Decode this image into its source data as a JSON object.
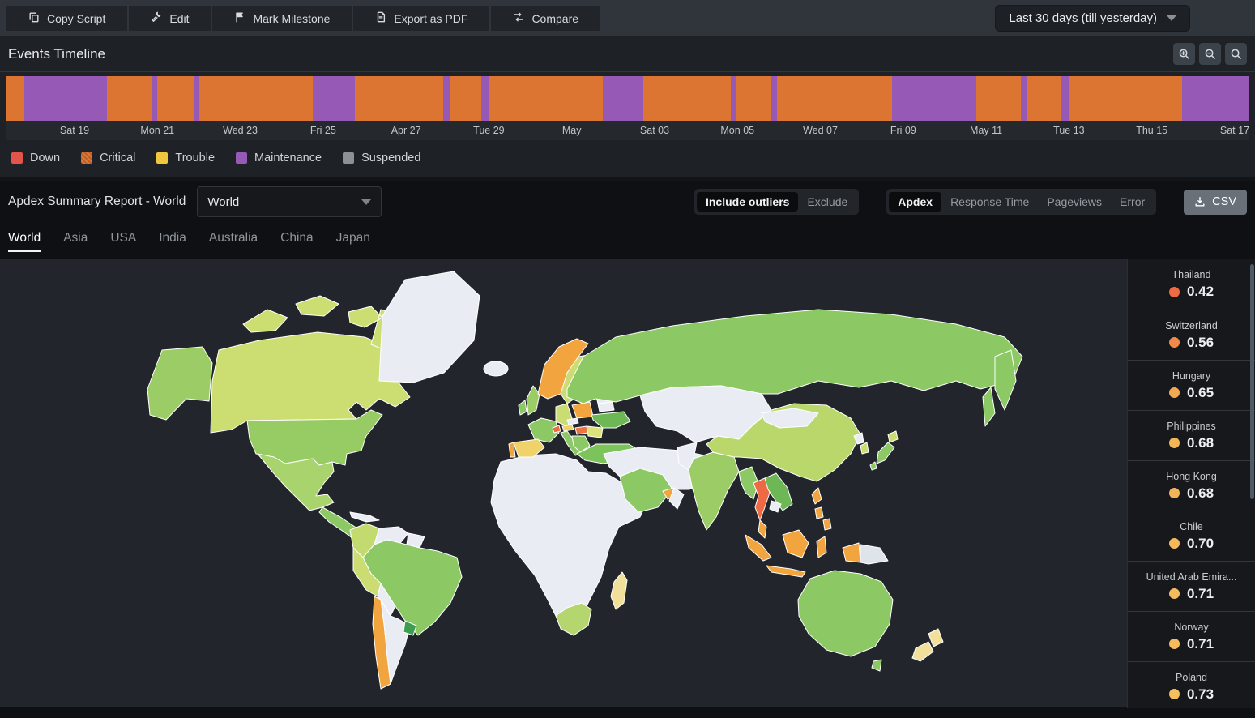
{
  "toolbar": {
    "buttons": [
      {
        "label": "Copy Script",
        "icon": "copy-icon"
      },
      {
        "label": "Edit",
        "icon": "edit-icon"
      },
      {
        "label": "Mark Milestone",
        "icon": "flag-icon"
      },
      {
        "label": "Export as PDF",
        "icon": "pdf-icon"
      },
      {
        "label": "Compare",
        "icon": "compare-icon"
      }
    ],
    "date_range": "Last 30 days (till yesterday)"
  },
  "events_timeline": {
    "title": "Events Timeline",
    "zoom_controls": [
      "zoom-in-icon",
      "zoom-out-icon",
      "zoom-reset-icon"
    ],
    "axis_labels": [
      "Sat 19",
      "Mon 21",
      "Wed 23",
      "Fri 25",
      "Apr 27",
      "Tue 29",
      "May",
      "Sat 03",
      "Mon 05",
      "Wed 07",
      "Fri 09",
      "May 11",
      "Tue 13",
      "Thu 15",
      "Sat 17"
    ],
    "segment_colors": {
      "critical": "#dd7532",
      "maintenance": "#9659b5"
    },
    "segments": [
      {
        "type": "critical",
        "width": 1.43
      },
      {
        "type": "maintenance",
        "width": 6.65
      },
      {
        "type": "critical",
        "width": 3.59
      },
      {
        "type": "maintenance",
        "width": 0.46
      },
      {
        "type": "critical",
        "width": 2.94
      },
      {
        "type": "maintenance",
        "width": 0.46
      },
      {
        "type": "critical",
        "width": 9.13
      },
      {
        "type": "maintenance",
        "width": 3.39
      },
      {
        "type": "critical",
        "width": 7.11
      },
      {
        "type": "maintenance",
        "width": 0.52
      },
      {
        "type": "critical",
        "width": 2.54
      },
      {
        "type": "maintenance",
        "width": 0.65
      },
      {
        "type": "critical",
        "width": 9.13
      },
      {
        "type": "maintenance",
        "width": 3.26
      },
      {
        "type": "critical",
        "width": 7.04
      },
      {
        "type": "maintenance",
        "width": 0.46
      },
      {
        "type": "critical",
        "width": 2.8
      },
      {
        "type": "maintenance",
        "width": 0.46
      },
      {
        "type": "critical",
        "width": 9.26
      },
      {
        "type": "maintenance",
        "width": 6.78
      },
      {
        "type": "critical",
        "width": 3.59
      },
      {
        "type": "maintenance",
        "width": 0.46
      },
      {
        "type": "critical",
        "width": 2.8
      },
      {
        "type": "maintenance",
        "width": 0.65
      },
      {
        "type": "critical",
        "width": 9.07
      },
      {
        "type": "maintenance",
        "width": 5.37
      }
    ],
    "legend": [
      {
        "label": "Down",
        "color": "#e3544a",
        "hatched": false
      },
      {
        "label": "Critical",
        "color": "#df7734",
        "hatched": true
      },
      {
        "label": "Trouble",
        "color": "#efc63d",
        "hatched": false
      },
      {
        "label": "Maintenance",
        "color": "#9659b5",
        "hatched": false
      },
      {
        "label": "Suspended",
        "color": "#8d9196",
        "hatched": false
      }
    ]
  },
  "report": {
    "title": "Apdex Summary Report - World",
    "scope_select_value": "World",
    "outlier_toggle": {
      "options": [
        "Include outliers",
        "Exclude"
      ],
      "active": "Include outliers"
    },
    "metric_tabs": {
      "options": [
        "Apdex",
        "Response Time",
        "Pageviews",
        "Error"
      ],
      "active": "Apdex"
    },
    "csv_label": "CSV",
    "region_tabs": {
      "options": [
        "World",
        "Asia",
        "USA",
        "India",
        "Australia",
        "China",
        "Japan"
      ],
      "active": "World"
    }
  },
  "map": {
    "ocean": "#22252b",
    "regions": {
      "greenland": "#e9edf3",
      "iceland": "#e9edf3",
      "canada": "#ccdd71",
      "arctic_islands": "#ccdd71",
      "alaska": "#9ccc66",
      "usa": "#97cb63",
      "mexico": "#a9d36d",
      "central_america": "#8cc863",
      "cuba": "#e9edf3",
      "colombia": "#c3da6e",
      "venezuela": "#e9edf3",
      "guyanas": "#e9edf3",
      "brazil": "#8cc863",
      "peru": "#cbdc72",
      "bolivia": "#e9edf3",
      "chile": "#f2a43e",
      "argentina": "#e9edf3",
      "uruguay": "#3e9e4f",
      "africa": "#e9edf3",
      "south_africa": "#b5d56f",
      "madagascar": "#f2df9a",
      "uk": "#9ccc66",
      "ireland": "#8cc863",
      "norway": "#f2a43e",
      "sweden": "#cbdc72",
      "finland": "#57a84f",
      "baltics": "#e9edf3",
      "france": "#8cc863",
      "germany": "#cbdc72",
      "spain": "#efd26a",
      "portugal": "#f2a43e",
      "italy": "#8cc863",
      "switzerland": "#ed6a44",
      "austria": "#f0d26a",
      "czech": "#e9edf3",
      "poland": "#f2a43e",
      "hungary": "#ec7544",
      "romania": "#dde27a",
      "ukraine": "#6db854",
      "belarus": "#e9edf3",
      "balkans": "#8cc863",
      "greece": "#b5d56f",
      "turkey": "#7dc35c",
      "russia": "#8cc863",
      "kamchatka": "#8cc863",
      "sakhalin": "#8cc863",
      "kazakhstan": "#e9edf3",
      "middle_east": "#e9edf3",
      "saudi_arabia": "#8cc863",
      "uae": "#f2a43e",
      "oman": "#e9edf3",
      "pakistan": "#e9edf3",
      "india": "#9ccc66",
      "china": "#b9d76a",
      "mongolia": "#e9edf3",
      "south_korea": "#cbdc72",
      "north_korea": "#e9edf3",
      "japan_honshu": "#8cc863",
      "japan_hokkaido": "#cbdc72",
      "myanmar": "#8cc863",
      "thailand": "#ed6a44",
      "vietnam": "#6db854",
      "cambodia": "#e9edf3",
      "malaysia": "#f2a43e",
      "sumatra": "#f2a43e",
      "java": "#f2a43e",
      "borneo": "#f2a43e",
      "sulawesi": "#f2a43e",
      "philippines": "#f2a43e",
      "png_west": "#f2a43e",
      "png_east": "#dfe3ea",
      "australia": "#8cc863",
      "tasmania": "#8cc863",
      "new_zealand": "#f2df9a"
    }
  },
  "country_scores": [
    {
      "name": "Thailand",
      "value": "0.42",
      "dot": "#ee6b43"
    },
    {
      "name": "Switzerland",
      "value": "0.56",
      "dot": "#ef8a4b"
    },
    {
      "name": "Hungary",
      "value": "0.65",
      "dot": "#f2a853"
    },
    {
      "name": "Philippines",
      "value": "0.68",
      "dot": "#f4b458"
    },
    {
      "name": "Hong Kong",
      "value": "0.68",
      "dot": "#f4b458"
    },
    {
      "name": "Chile",
      "value": "0.70",
      "dot": "#f5b95b"
    },
    {
      "name": "United Arab Emira...",
      "value": "0.71",
      "dot": "#f5bb5c"
    },
    {
      "name": "Norway",
      "value": "0.71",
      "dot": "#f5bb5c"
    },
    {
      "name": "Poland",
      "value": "0.73",
      "dot": "#f6bf5f"
    }
  ]
}
